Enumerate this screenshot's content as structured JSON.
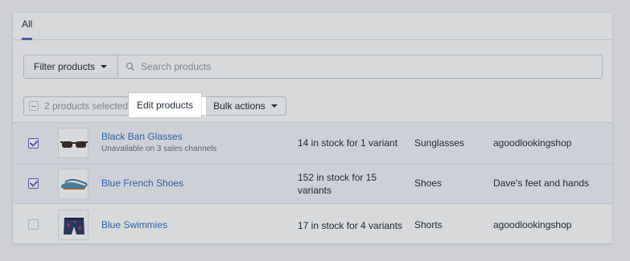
{
  "tabs": [
    {
      "label": "All",
      "active": true
    }
  ],
  "filter": {
    "label": "Filter products",
    "search_placeholder": "Search products"
  },
  "bulk": {
    "selected_text": "2 products selected",
    "edit_label": "Edit products",
    "actions_label": "Bulk actions"
  },
  "products": [
    {
      "name": "Black Ban Glasses",
      "subtext": "Unavailable on 3 sales channels",
      "stock": "14 in stock for 1 variant",
      "type": "Sunglasses",
      "vendor": "agoodlookingshop",
      "checked": true
    },
    {
      "name": "Blue French Shoes",
      "subtext": "",
      "stock": "152 in stock for 15 variants",
      "type": "Shoes",
      "vendor": "Dave's feet and hands",
      "checked": true
    },
    {
      "name": "Blue Swimmies",
      "subtext": "",
      "stock": "17 in stock for 4 variants",
      "type": "Shorts",
      "vendor": "agoodlookingshop",
      "checked": false
    }
  ],
  "colors": {
    "accent": "#5c6ac4",
    "link": "#2a6fc9",
    "border": "#c4cdd5",
    "muted": "#919eab"
  },
  "icons": {
    "search": "search-icon",
    "caret": "caret-down-icon",
    "minus": "minus-icon",
    "check": "checkmark-icon"
  }
}
